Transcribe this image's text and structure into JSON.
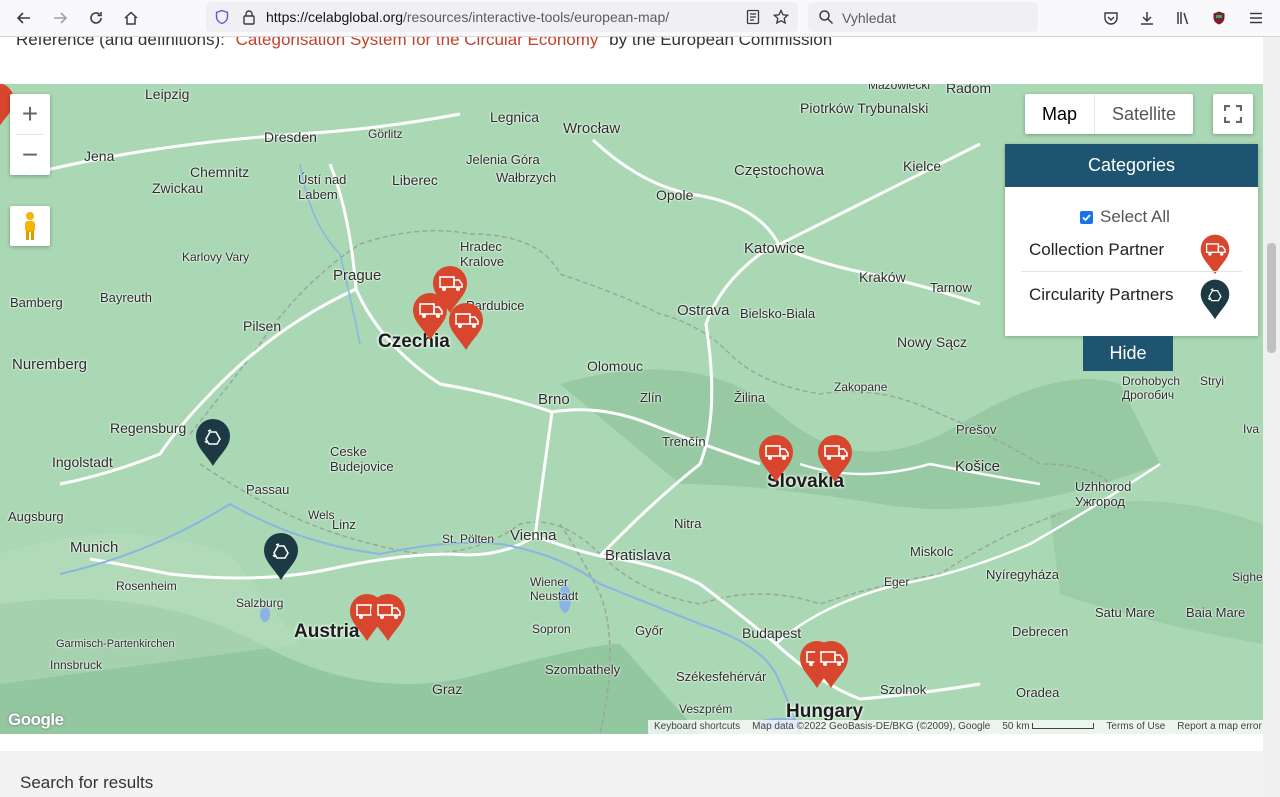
{
  "browser": {
    "url_domain": "https://celabglobal.org",
    "url_path": "/resources/interactive-tools/european-map/",
    "search_placeholder": "Vyhledat"
  },
  "page": {
    "reference_prefix": "Reference (and definitions): ",
    "reference_link": "\"Categorisation System for the Circular Economy\"",
    "reference_suffix": " by the European Commission",
    "search_results_label": "Search for results"
  },
  "map": {
    "maptype_buttons": [
      "Map",
      "Satellite"
    ],
    "active_maptype": "Map",
    "zoom_in": "+",
    "zoom_out": "−",
    "countries": [
      "Czechia",
      "Slovakia",
      "Austria",
      "Hungary"
    ],
    "cities": [
      "Leipzig",
      "Dresden",
      "Görlitz",
      "Legnica",
      "Wrocław",
      "Piotrków Trybunalski",
      "Mazowiecki",
      "Radom",
      "Jena",
      "Chemnitz",
      "Ústí nad Labem",
      "Liberec",
      "Jelenia Góra",
      "Wałbrzych",
      "Opole",
      "Częstochowa",
      "Kielce",
      "Zwickau",
      "Hradec Kralove",
      "Katowice",
      "Kraków",
      "Tarnow",
      "Karlovy Vary",
      "Prague",
      "Pardubice",
      "Ostrava",
      "Bielsko-Biala",
      "Bamberg",
      "Bayreuth",
      "Pilsen",
      "Olomouc",
      "Nowy Sącz",
      "Nuremberg",
      "Brno",
      "Zlín",
      "Zakopane",
      "Žilina",
      "Drohobych Дрогобич",
      "Regensburg",
      "Ceske Budejovice",
      "Trenčín",
      "Prešov",
      "Ingolstadt",
      "Passau",
      "Košice",
      "Uzhhorod Ужгород",
      "Augsburg",
      "Linz",
      "Vienna",
      "Bratislava",
      "Nitra",
      "Munich",
      "Wels",
      "St. Pölten",
      "Miskolc",
      "Nyíregyháza",
      "Rosenheim",
      "Salzburg",
      "Wiener Neustadt",
      "Eger",
      "Satu Mare",
      "Baia Mare",
      "Sopron",
      "Győr",
      "Budapest",
      "Debrecen",
      "Garmisch-Partenkirchen",
      "Innsbruck",
      "Szombathely",
      "Székesfehérvár",
      "Oradea",
      "Graz",
      "Szolnok",
      "Veszprém",
      "Stryi",
      "Sighetu",
      "Iva"
    ],
    "attribution": [
      "Keyboard shortcuts",
      "Map data ©2022 GeoBasis-DE/BKG (©2009), Google",
      "50 km",
      "Terms of Use",
      "Report a map error"
    ],
    "google_logo": "Google"
  },
  "categories": {
    "title": "Categories",
    "select_all": "Select All",
    "items": [
      {
        "label": "Collection Partner",
        "color": "#d8462e",
        "icon": "truck-icon"
      },
      {
        "label": "Circularity Partners",
        "color": "#1d3a44",
        "icon": "recycle-icon"
      }
    ],
    "hide_button": "Hide"
  }
}
